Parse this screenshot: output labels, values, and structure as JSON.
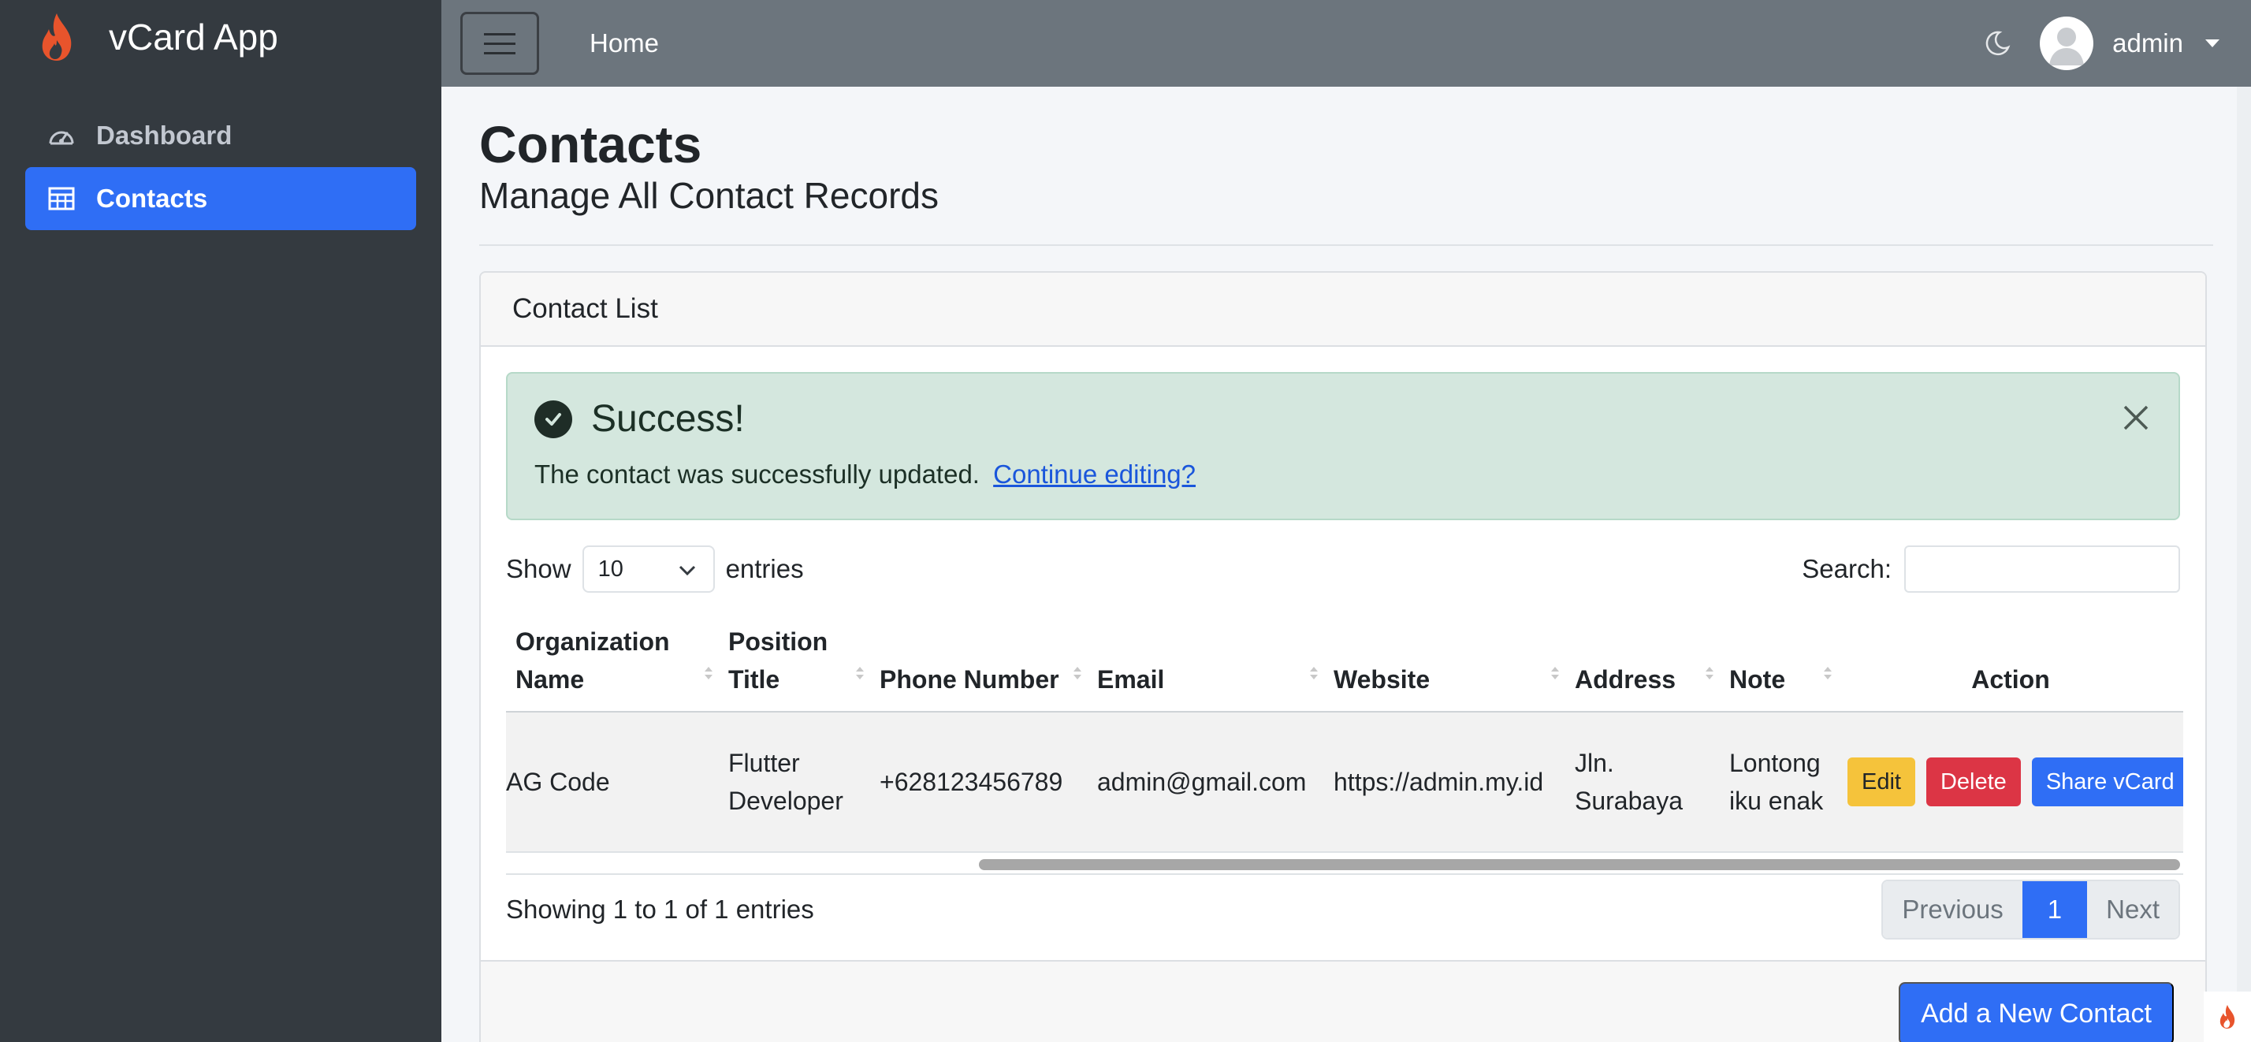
{
  "brand": {
    "name": "vCard App",
    "logo_icon": "flame-icon"
  },
  "sidebar": {
    "items": [
      {
        "label": "Dashboard",
        "icon": "gauge-icon",
        "active": false
      },
      {
        "label": "Contacts",
        "icon": "table-icon",
        "active": true
      }
    ]
  },
  "topbar": {
    "home_label": "Home",
    "user_name": "admin"
  },
  "page": {
    "title": "Contacts",
    "subtitle": "Manage All Contact Records"
  },
  "card": {
    "title": "Contact List",
    "add_button": "Add a New Contact"
  },
  "alert": {
    "title": "Success!",
    "message": "The contact was successfully updated.",
    "link": "Continue editing?"
  },
  "table_controls": {
    "show_label": "Show",
    "page_size": "10",
    "entries_label": "entries",
    "search_label": "Search:"
  },
  "table": {
    "columns": [
      "Organization Name",
      "Position Title",
      "Phone Number",
      "Email",
      "Website",
      "Address",
      "Note",
      "Action"
    ],
    "rows": [
      {
        "organization": "AG Code",
        "position": "Flutter Developer",
        "phone": "+628123456789",
        "email": "admin@gmail.com",
        "website": "https://admin.my.id",
        "address": "Jln. Surabaya",
        "note": "Lontong iku enak",
        "actions": [
          "Edit",
          "Delete",
          "Share vCard"
        ]
      }
    ]
  },
  "pagination": {
    "info": "Showing 1 to 1 of 1 entries",
    "previous": "Previous",
    "current": "1",
    "next": "Next"
  },
  "colors": {
    "primary": "#2f6ef5",
    "sidebar_bg": "#343a40",
    "topbar_bg": "#6c757d",
    "success_bg": "#d4e7de",
    "warning": "#f5c33b",
    "danger": "#dc3545",
    "flame": "#e8542c"
  }
}
